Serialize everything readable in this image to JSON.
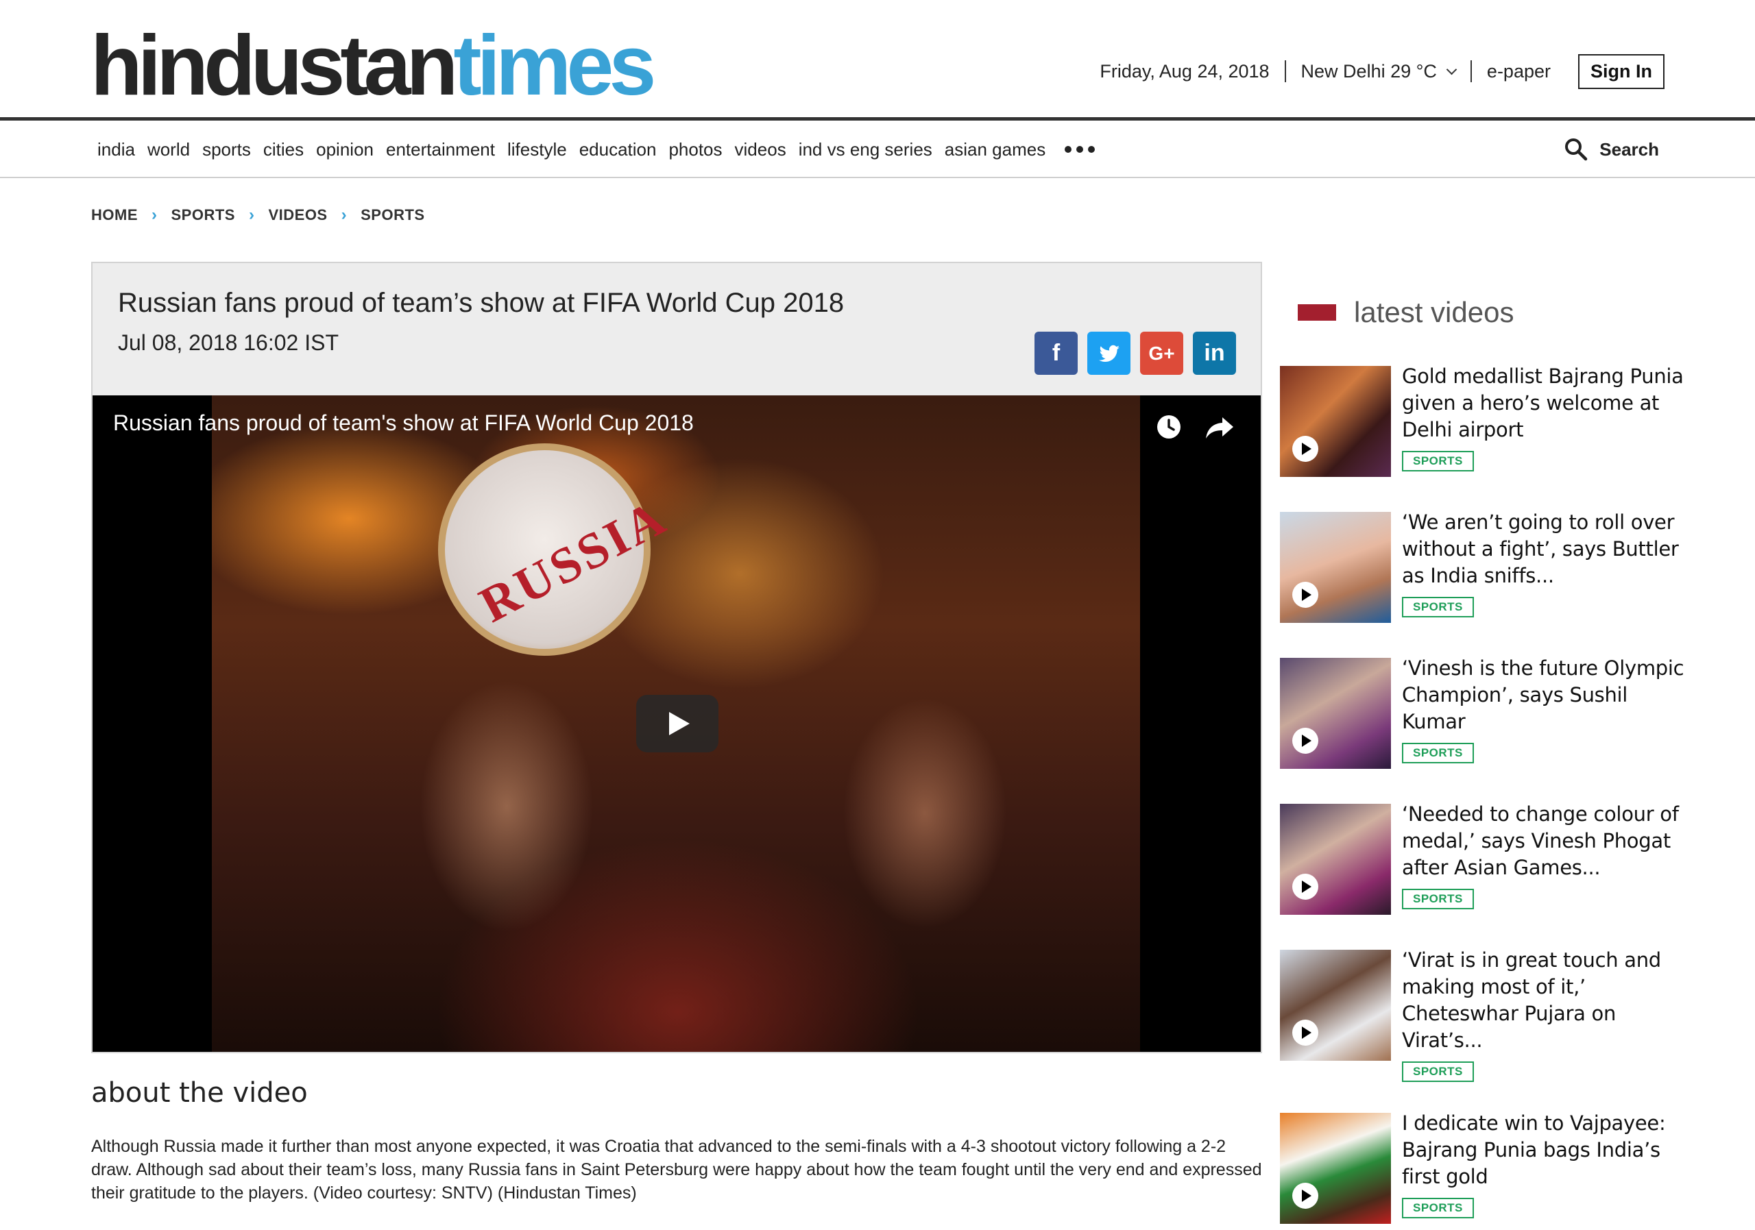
{
  "logo": {
    "part1": "hindustan",
    "part2": "times"
  },
  "topbar": {
    "date": "Friday, Aug 24, 2018",
    "weather": "New Delhi 29 °C",
    "epaper": "e-paper",
    "signin": "Sign In"
  },
  "nav": {
    "items": [
      "india",
      "world",
      "sports",
      "cities",
      "opinion",
      "entertainment",
      "lifestyle",
      "education",
      "photos",
      "videos",
      "ind vs eng series",
      "asian games"
    ],
    "search_label": "Search"
  },
  "breadcrumb": [
    "HOME",
    "SPORTS",
    "VIDEOS",
    "SPORTS"
  ],
  "article": {
    "title": "Russian fans proud of team’s show at FIFA World Cup 2018",
    "date": "Jul 08, 2018 16:02 IST",
    "player_title": "Russian fans proud of team's show at FIFA World Cup 2018",
    "hat_text": "RUSSIA",
    "share": {
      "facebook": "f",
      "twitter": "t",
      "google": "G+",
      "linkedin": "in"
    }
  },
  "about": {
    "heading": "about the video",
    "body": "Although Russia made it further than most anyone expected, it was Croatia that advanced to the semi-finals with a 4-3 shootout victory following a 2-2 draw. Although sad about their team’s loss, many Russia fans in Saint Petersburg were happy about how the team fought until the very end and expressed their gratitude to the players. (Video courtesy: SNTV) (Hindustan Times)"
  },
  "sidebar": {
    "heading": "latest videos",
    "videos": [
      {
        "title": "Gold medallist Bajrang Punia given a hero’s welcome at Delhi airport",
        "tag": "SPORTS"
      },
      {
        "title": "‘We aren’t going to roll over without a fight’, says Buttler as India sniffs...",
        "tag": "SPORTS"
      },
      {
        "title": "‘Vinesh is the future Olympic Champion’, says Sushil Kumar",
        "tag": "SPORTS"
      },
      {
        "title": "‘Needed to change colour of medal,’ says Vinesh Phogat after Asian Games...",
        "tag": "SPORTS"
      },
      {
        "title": "‘Virat is in great touch and making most of it,’ Cheteswhar Pujara on Virat’s...",
        "tag": "SPORTS"
      },
      {
        "title": "I dedicate win to Vajpayee: Bajrang Punia bags India’s first gold",
        "tag": "SPORTS"
      }
    ]
  },
  "colors": {
    "brand_blue": "#3aa2d6",
    "accent_red": "#a31f2e",
    "tag_green": "#1e9e58"
  }
}
